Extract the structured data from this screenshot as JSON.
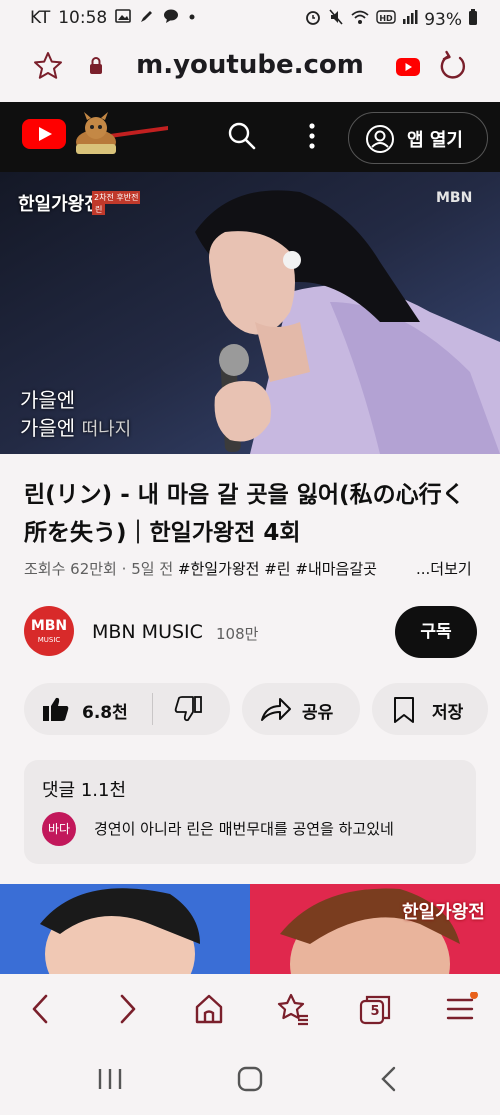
{
  "status_bar": {
    "carrier": "KT",
    "time": "10:58",
    "battery": "93%",
    "icons": [
      "gallery-icon",
      "pen-icon",
      "chat-icon",
      "dot-icon",
      "alarm-icon",
      "mute-icon",
      "wifi-icon",
      "hd-icon",
      "signal-icon",
      "battery-icon"
    ]
  },
  "browser": {
    "url": "m.youtube.com",
    "icons": [
      "star-icon",
      "lock-icon",
      "youtube-icon",
      "reload-icon"
    ]
  },
  "yt_header": {
    "open_app_label": "앱 열기",
    "icons": [
      "youtube-logo",
      "doodle-icon",
      "search-icon",
      "more-vert-icon",
      "account-icon"
    ]
  },
  "video": {
    "badge_title": "한일가왕전",
    "badge_sub": "2차전 후반전",
    "badge_name": "린",
    "watermark": "MBN",
    "caption_line1": "가을엔",
    "caption_line2": "가을엔",
    "caption_line2b": "떠나지"
  },
  "title": "린(リン) - 내 마음 갈 곳을 잃어(私の心行く所を失う)｜한일가왕전 4회",
  "meta": {
    "views": "조회수 62만회",
    "age": "5일 전",
    "tags": "#한일가왕전 #린 #내마음갈곳",
    "more": "...더보기"
  },
  "channel": {
    "avatar_line1": "MBN",
    "avatar_line2": "MUSIC",
    "name": "MBN MUSIC",
    "subscribers": "108만",
    "subscribe_label": "구독"
  },
  "actions": {
    "likes": "6.8천",
    "share_label": "공유",
    "save_label": "저장"
  },
  "comments": {
    "label": "댓글",
    "count": "1.1천",
    "top_avatar": "바다",
    "top_text": "경연이 아니라 린은 매번무대를 공연을 하고있네"
  },
  "next_video": {
    "logo_text": "한일가왕전"
  },
  "bottom_bar": {
    "tab_count": "5",
    "icons": [
      "back-icon",
      "forward-icon",
      "home-icon",
      "bookmarks-icon",
      "tabs-icon",
      "menu-icon"
    ]
  },
  "nav_bar": {
    "icons": [
      "recents-icon",
      "home-button-icon",
      "nav-back-icon"
    ]
  },
  "colors": {
    "youtube_red": "#ff0000",
    "header_bg": "#0f0f0f",
    "browser_accent": "#7a1f2b",
    "subscribe_bg": "#0f0f0f"
  }
}
